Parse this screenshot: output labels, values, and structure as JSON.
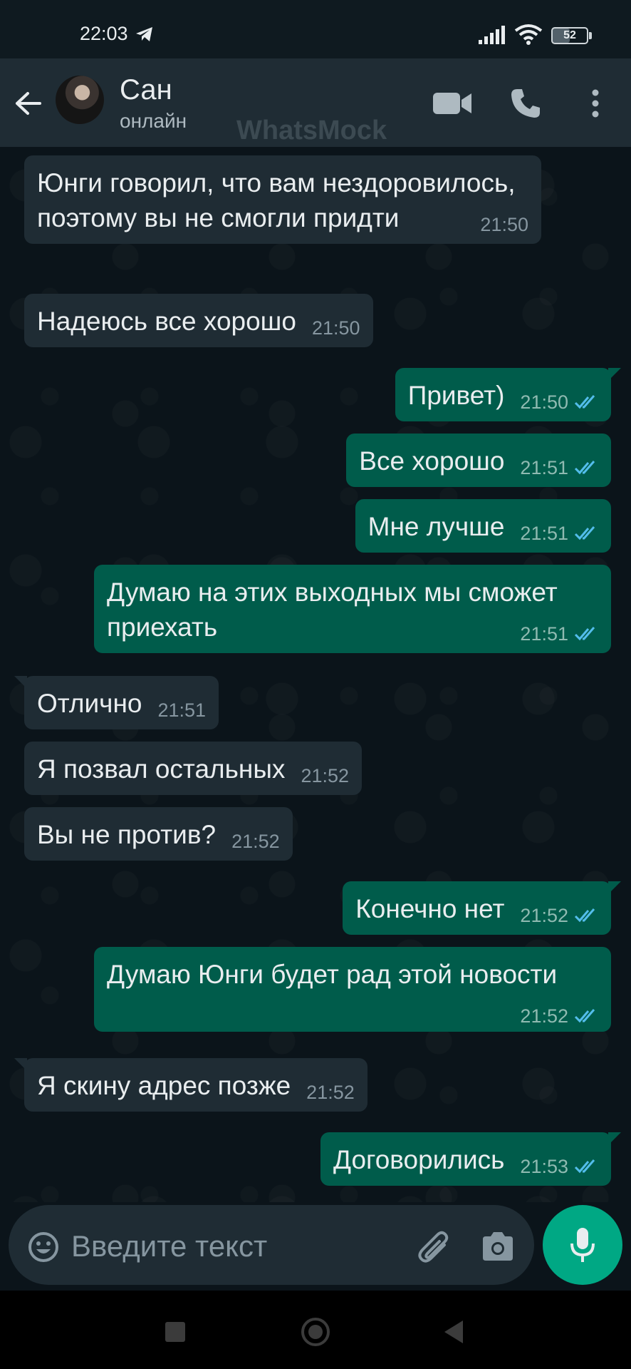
{
  "status_bar": {
    "time": "22:03",
    "battery": "52"
  },
  "header": {
    "contact_name": "Сан",
    "contact_status": "онлайн",
    "watermark": "WhatsMock"
  },
  "messages": [
    {
      "direction": "in",
      "text": "Юнги говорил, что вам нездоровилось, поэтому вы не смогли придти",
      "time": "21:50"
    },
    {
      "direction": "in",
      "text": "Надеюсь все хорошо",
      "time": "21:50"
    },
    {
      "direction": "out",
      "text": "Привет)",
      "time": "21:50",
      "read": true
    },
    {
      "direction": "out",
      "text": "Все хорошо",
      "time": "21:51",
      "read": true
    },
    {
      "direction": "out",
      "text": "Мне лучше",
      "time": "21:51",
      "read": true
    },
    {
      "direction": "out",
      "text": "Думаю на этих выходных мы сможет приехать",
      "time": "21:51",
      "read": true
    },
    {
      "direction": "in",
      "text": "Отлично",
      "time": "21:51"
    },
    {
      "direction": "in",
      "text": "Я позвал остальных",
      "time": "21:52"
    },
    {
      "direction": "in",
      "text": "Вы не против?",
      "time": "21:52"
    },
    {
      "direction": "out",
      "text": "Конечно нет",
      "time": "21:52",
      "read": true
    },
    {
      "direction": "out",
      "text": "Думаю Юнги будет рад этой новости",
      "time": "21:52",
      "read": true
    },
    {
      "direction": "in",
      "text": "Я скину адрес позже",
      "time": "21:52"
    },
    {
      "direction": "out",
      "text": "Договорились",
      "time": "21:53",
      "read": true
    }
  ],
  "composer": {
    "placeholder": "Введите текст"
  },
  "icons": {
    "back": "arrow-left-icon",
    "video": "video-camera-icon",
    "call": "phone-icon",
    "menu": "more-vertical-icon",
    "emoji": "emoji-icon",
    "attach": "paperclip-icon",
    "camera": "camera-icon",
    "mic": "microphone-icon",
    "read_receipt": "double-check-icon"
  },
  "colors": {
    "background": "#0b141a",
    "header": "#1f2c34",
    "incoming_bubble": "#1f2c34",
    "outgoing_bubble": "#005c4b",
    "accent": "#00a884",
    "read_tick": "#53bdeb"
  }
}
